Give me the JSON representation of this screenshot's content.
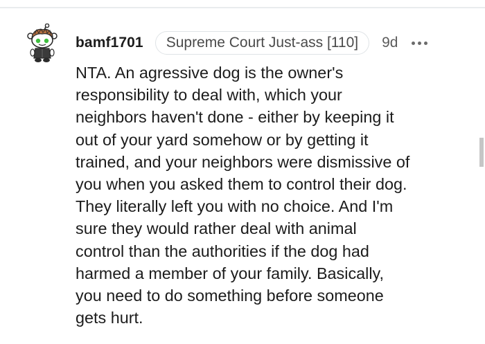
{
  "comment": {
    "username": "bamf1701",
    "flair": "Supreme Court Just-ass [110]",
    "timestamp": "9d",
    "more_icon": "more-horizontal-icon",
    "avatar_icon": "reddit-snoo-avatar-icon",
    "body": "NTA. An agressive dog is the owner's\nresponsibility to deal with, which your\nneighbors haven't done - either by keeping it\nout of your yard somehow or by getting it\ntrained, and your neighbors were dismissive of\nyou when you asked them to control their dog.\nThey literally left you with no choice. And I'm\nsure they would rather deal with animal\ncontrol than the authorities if the dog had\nharmed a member of your family. Basically,\nyou need to do something before someone\ngets hurt."
  },
  "colors": {
    "text": "#1c1c1c",
    "meta_text": "#5b5b5b",
    "flair_border": "#dfe3e6",
    "avatar_hair": "#b7703f",
    "avatar_eyes": "#3fbf3f",
    "divider": "#e9ecee"
  }
}
